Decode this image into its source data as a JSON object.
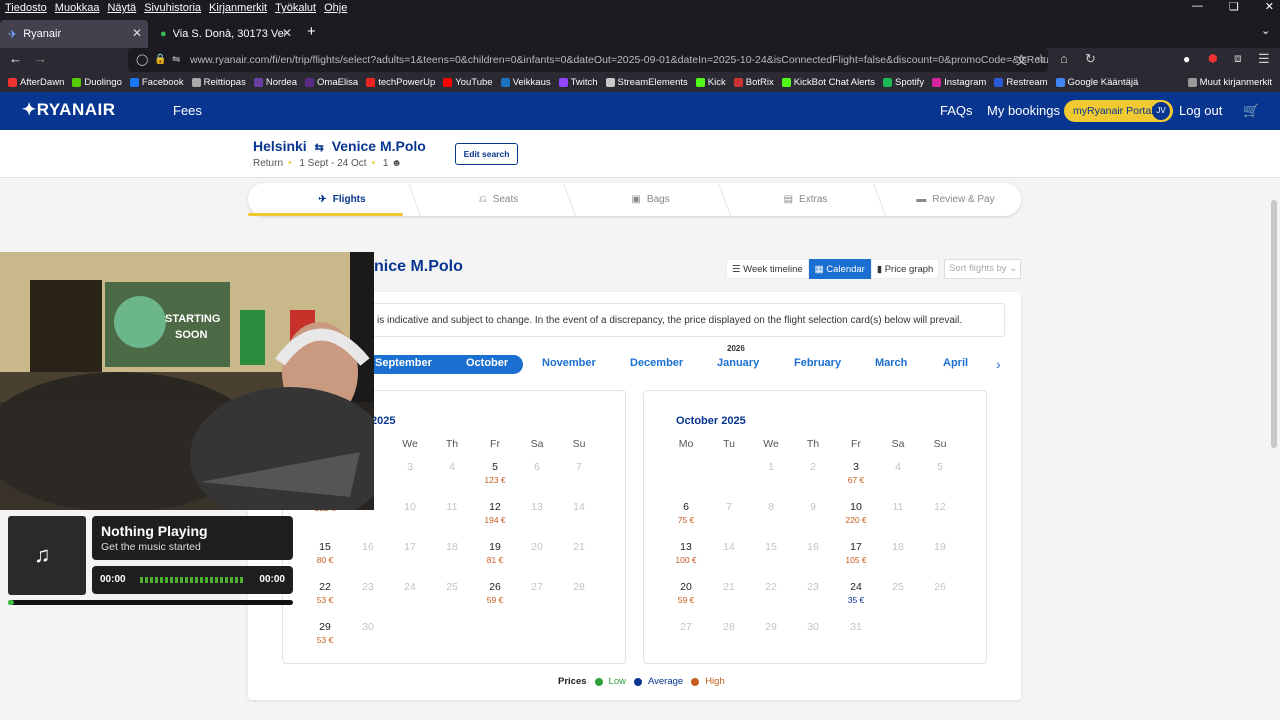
{
  "menubar": {
    "items": [
      "Tiedosto",
      "Muokkaa",
      "Näytä",
      "Sivuhistoria",
      "Kirjanmerkit",
      "Työkalut",
      "Ohje"
    ]
  },
  "tabs": [
    {
      "title": "Ryanair"
    },
    {
      "title": "Via S. Donà, 30173 Venezia VE, I"
    }
  ],
  "url": "www.ryanair.com/fi/en/trip/flights/select?adults=1&teens=0&children=0&infants=0&dateOut=2025-09-01&dateIn=2025-10-24&isConnectedFlight=false&discount=0&promoCode=&isReturn=true&o",
  "bookmarks": [
    "AfterDawn",
    "Duolingo",
    "Facebook",
    "Reittiopas",
    "Nordea",
    "OmaElisa",
    "techPowerUp",
    "YouTube",
    "Veikkaus",
    "Twitch",
    "StreamElements",
    "Kick",
    "BotRix",
    "KickBot Chat Alerts",
    "Spotify",
    "Instagram",
    "Restream",
    "Google Kääntäjä",
    "Muut kirjanmerkit"
  ],
  "bookmark_colors": [
    "#e33",
    "#58cc02",
    "#1877f2",
    "#aaa",
    "#6a3fa0",
    "#5b2a86",
    "#e22",
    "#f00",
    "#1e73be",
    "#9146ff",
    "#c9c9c9",
    "#53fc18",
    "#c33",
    "#53fc18",
    "#1db954",
    "#d6249f",
    "#2a5bd7",
    "#4285f4",
    "#999"
  ],
  "header": {
    "logo": "RYANAIR",
    "fees": "Fees",
    "faqs": "FAQs",
    "my_bookings": "My bookings",
    "portal": "myRyanair Portal",
    "initials": "JV",
    "logout": "Log out"
  },
  "trip": {
    "origin": "Helsinki",
    "destination": "Venice M.Polo",
    "type": "Return",
    "dates": "1 Sept - 24 Oct",
    "passengers": "1",
    "edit": "Edit search"
  },
  "steps": [
    "Flights",
    "Seats",
    "Bags",
    "Extras",
    "Review & Pay"
  ],
  "section": {
    "heading_visible": "nice M.Polo",
    "views": [
      "Week timeline",
      "Calendar",
      "Price graph"
    ],
    "sort": "Sort flights by",
    "notice_visible": "is indicative and subject to change. In the event of a discrepancy, the price displayed on the flight selection card(s) below will prevail."
  },
  "months": [
    "September",
    "October",
    "November",
    "December",
    "January",
    "February",
    "March",
    "April"
  ],
  "year_label": "2026",
  "calendars": {
    "left_title_visible": "2025",
    "right_title": "October 2025",
    "weekdays": [
      "Mo",
      "Tu",
      "We",
      "Th",
      "Fr",
      "Sa",
      "Su"
    ]
  },
  "legend": {
    "label": "Prices",
    "low": "Low",
    "average": "Average",
    "high": "High",
    "low_color": "#2e9e3c",
    "avg_color": "#073590",
    "high_color": "#c45c1e"
  },
  "player": {
    "title": "Nothing Playing",
    "subtitle": "Get the music started",
    "time_left": "00:00",
    "time_right": "00:00"
  }
}
